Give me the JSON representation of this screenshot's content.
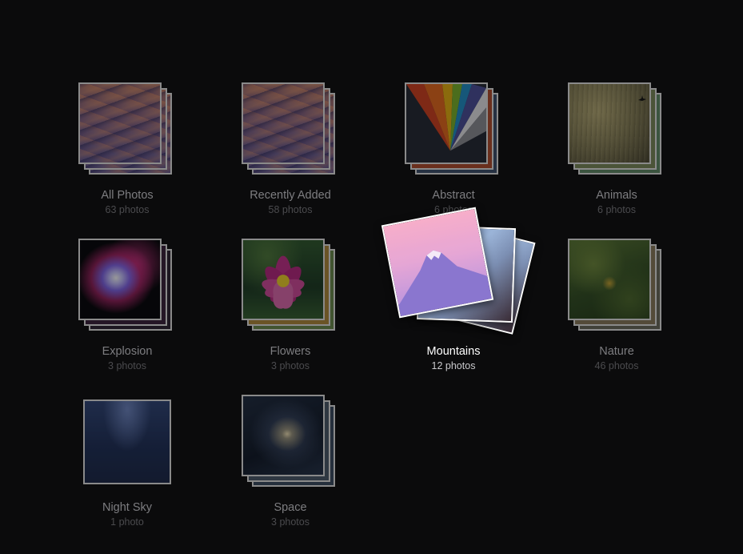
{
  "albums": [
    {
      "title": "All Photos",
      "count": "63 photos",
      "thumb": "desert-dunes-image"
    },
    {
      "title": "Recently Added",
      "count": "58 photos",
      "thumb": "desert-dunes-image"
    },
    {
      "title": "Abstract",
      "count": "6 photos",
      "thumb": "color-prism-image"
    },
    {
      "title": "Animals",
      "count": "6 photos",
      "thumb": "foggy-forest-bird-image"
    },
    {
      "title": "Explosion",
      "count": "3 photos",
      "thumb": "color-powder-explosion-image"
    },
    {
      "title": "Flowers",
      "count": "3 photos",
      "thumb": "pink-lotus-image"
    },
    {
      "title": "Mountains",
      "count": "12 photos",
      "thumb": "pink-mountain-image",
      "active": true
    },
    {
      "title": "Nature",
      "count": "46 photos",
      "thumb": "green-leaves-image"
    },
    {
      "title": "Night Sky",
      "count": "1 photo",
      "thumb": "milky-way-image"
    },
    {
      "title": "Space",
      "count": "3 photos",
      "thumb": "galaxy-image"
    }
  ],
  "colors": {
    "background": "#0b0b0c",
    "title_dim": "#7d7d80",
    "count_dim": "#4b4b4e",
    "title_active": "#ffffff",
    "count_active": "#c9c9cc"
  }
}
